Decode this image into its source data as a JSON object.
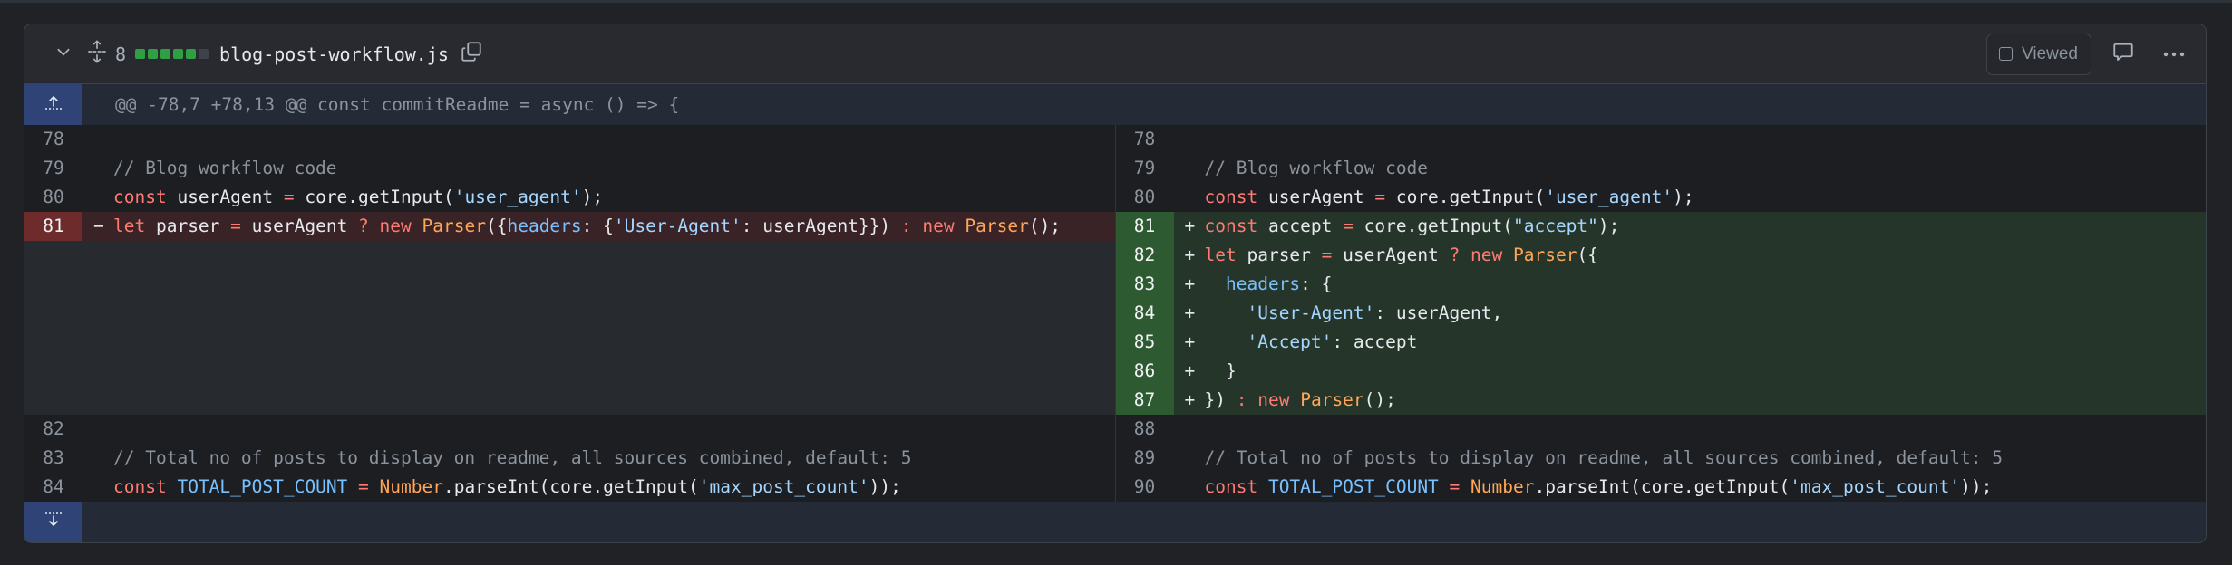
{
  "colors": {
    "added_line_bg": "#26352a",
    "added_number_bg": "#2e5a32",
    "deleted_line_bg": "#3a2326",
    "deleted_number_bg": "#6e2b2c",
    "expander_bg": "#2f4377",
    "diffstat_added": "#2ea043",
    "diffstat_neutral": "#3d434b"
  },
  "file": {
    "changes_count": "8",
    "diffstat": [
      "added",
      "added",
      "added",
      "added",
      "added",
      "neutral"
    ],
    "filename": "blog-post-workflow.js",
    "viewed_label": "Viewed",
    "viewed_checked": false,
    "icons": {
      "collapse": "chevron-down-icon",
      "expand_all": "unfold-icon",
      "copy": "copy-icon",
      "comment": "comment-icon",
      "more": "kebab-horizontal-icon",
      "expand_up": "expand-up-icon",
      "expand_down": "expand-down-icon"
    }
  },
  "hunk": {
    "header": "@@ -78,7 +78,13 @@ const commitReadme = async () => {"
  },
  "rows": [
    {
      "left": {
        "num": "78",
        "type": "context",
        "tokens": []
      },
      "right": {
        "num": "78",
        "type": "context",
        "tokens": []
      }
    },
    {
      "left": {
        "num": "79",
        "type": "context",
        "tokens": [
          [
            "com",
            "// Blog workflow code"
          ]
        ]
      },
      "right": {
        "num": "79",
        "type": "context",
        "tokens": [
          [
            "com",
            "// Blog workflow code"
          ]
        ]
      }
    },
    {
      "left": {
        "num": "80",
        "type": "context",
        "tokens": [
          [
            "kw",
            "const"
          ],
          [
            "",
            " userAgent "
          ],
          [
            "op",
            "="
          ],
          [
            "",
            " core.getInput("
          ],
          [
            "str",
            "'user_agent'"
          ],
          [
            "",
            ");"
          ]
        ]
      },
      "right": {
        "num": "80",
        "type": "context",
        "tokens": [
          [
            "kw",
            "const"
          ],
          [
            "",
            " userAgent "
          ],
          [
            "op",
            "="
          ],
          [
            "",
            " core.getInput("
          ],
          [
            "str",
            "'user_agent'"
          ],
          [
            "",
            ");"
          ]
        ]
      }
    },
    {
      "left": {
        "num": "81",
        "type": "del",
        "marker": "−",
        "tokens": [
          [
            "kw",
            "let"
          ],
          [
            "",
            " parser "
          ],
          [
            "op",
            "="
          ],
          [
            "",
            " userAgent "
          ],
          [
            "op",
            "?"
          ],
          [
            "",
            " "
          ],
          [
            "kw",
            "new"
          ],
          [
            "",
            " "
          ],
          [
            "cls",
            "Parser"
          ],
          [
            "",
            "({"
          ],
          [
            "prop",
            "headers"
          ],
          [
            "",
            ": {"
          ],
          [
            "str",
            "'User-Agent'"
          ],
          [
            "",
            ": userAgent}}) "
          ],
          [
            "op",
            ":"
          ],
          [
            "",
            " "
          ],
          [
            "kw",
            "new"
          ],
          [
            "",
            " "
          ],
          [
            "cls",
            "Parser"
          ],
          [
            "",
            "();"
          ]
        ]
      },
      "right": {
        "num": "81",
        "type": "add",
        "marker": "+",
        "tokens": [
          [
            "kw",
            "const"
          ],
          [
            "",
            " accept "
          ],
          [
            "op",
            "="
          ],
          [
            "",
            " core.getInput("
          ],
          [
            "str",
            "\"accept\""
          ],
          [
            "",
            ");"
          ]
        ]
      }
    },
    {
      "left": {
        "num": "",
        "type": "empty",
        "tokens": []
      },
      "right": {
        "num": "82",
        "type": "add",
        "marker": "+",
        "tokens": [
          [
            "kw",
            "let"
          ],
          [
            "",
            " parser "
          ],
          [
            "op",
            "="
          ],
          [
            "",
            " userAgent "
          ],
          [
            "op",
            "?"
          ],
          [
            "",
            " "
          ],
          [
            "kw",
            "new"
          ],
          [
            "",
            " "
          ],
          [
            "cls",
            "Parser"
          ],
          [
            "",
            "({"
          ]
        ]
      }
    },
    {
      "left": {
        "num": "",
        "type": "empty",
        "tokens": []
      },
      "right": {
        "num": "83",
        "type": "add",
        "marker": "+",
        "tokens": [
          [
            "",
            "  "
          ],
          [
            "prop",
            "headers"
          ],
          [
            "",
            ": {"
          ]
        ]
      }
    },
    {
      "left": {
        "num": "",
        "type": "empty",
        "tokens": []
      },
      "right": {
        "num": "84",
        "type": "add",
        "marker": "+",
        "tokens": [
          [
            "",
            "    "
          ],
          [
            "str",
            "'User-Agent'"
          ],
          [
            "",
            ": userAgent,"
          ]
        ]
      }
    },
    {
      "left": {
        "num": "",
        "type": "empty",
        "tokens": []
      },
      "right": {
        "num": "85",
        "type": "add",
        "marker": "+",
        "tokens": [
          [
            "",
            "    "
          ],
          [
            "str",
            "'Accept'"
          ],
          [
            "",
            ": accept"
          ]
        ]
      }
    },
    {
      "left": {
        "num": "",
        "type": "empty",
        "tokens": []
      },
      "right": {
        "num": "86",
        "type": "add",
        "marker": "+",
        "tokens": [
          [
            "",
            "  }"
          ]
        ]
      }
    },
    {
      "left": {
        "num": "",
        "type": "empty",
        "tokens": []
      },
      "right": {
        "num": "87",
        "type": "add",
        "marker": "+",
        "tokens": [
          [
            "",
            "}) "
          ],
          [
            "op",
            ":"
          ],
          [
            "",
            " "
          ],
          [
            "kw",
            "new"
          ],
          [
            "",
            " "
          ],
          [
            "cls",
            "Parser"
          ],
          [
            "",
            "();"
          ]
        ]
      }
    },
    {
      "left": {
        "num": "82",
        "type": "context",
        "tokens": []
      },
      "right": {
        "num": "88",
        "type": "context",
        "tokens": []
      }
    },
    {
      "left": {
        "num": "83",
        "type": "context",
        "tokens": [
          [
            "com",
            "// Total no of posts to display on readme, all sources combined, default: 5"
          ]
        ]
      },
      "right": {
        "num": "89",
        "type": "context",
        "tokens": [
          [
            "com",
            "// Total no of posts to display on readme, all sources combined, default: 5"
          ]
        ]
      }
    },
    {
      "left": {
        "num": "84",
        "type": "context",
        "tokens": [
          [
            "kw",
            "const"
          ],
          [
            "",
            " "
          ],
          [
            "prop",
            "TOTAL_POST_COUNT"
          ],
          [
            "",
            " "
          ],
          [
            "op",
            "="
          ],
          [
            "",
            " "
          ],
          [
            "cls",
            "Number"
          ],
          [
            "",
            ".parseInt(core.getInput("
          ],
          [
            "str",
            "'max_post_count'"
          ],
          [
            "",
            "));"
          ]
        ]
      },
      "right": {
        "num": "90",
        "type": "context",
        "tokens": [
          [
            "kw",
            "const"
          ],
          [
            "",
            " "
          ],
          [
            "prop",
            "TOTAL_POST_COUNT"
          ],
          [
            "",
            " "
          ],
          [
            "op",
            "="
          ],
          [
            "",
            " "
          ],
          [
            "cls",
            "Number"
          ],
          [
            "",
            ".parseInt(core.getInput("
          ],
          [
            "str",
            "'max_post_count'"
          ],
          [
            "",
            "));"
          ]
        ]
      }
    }
  ]
}
